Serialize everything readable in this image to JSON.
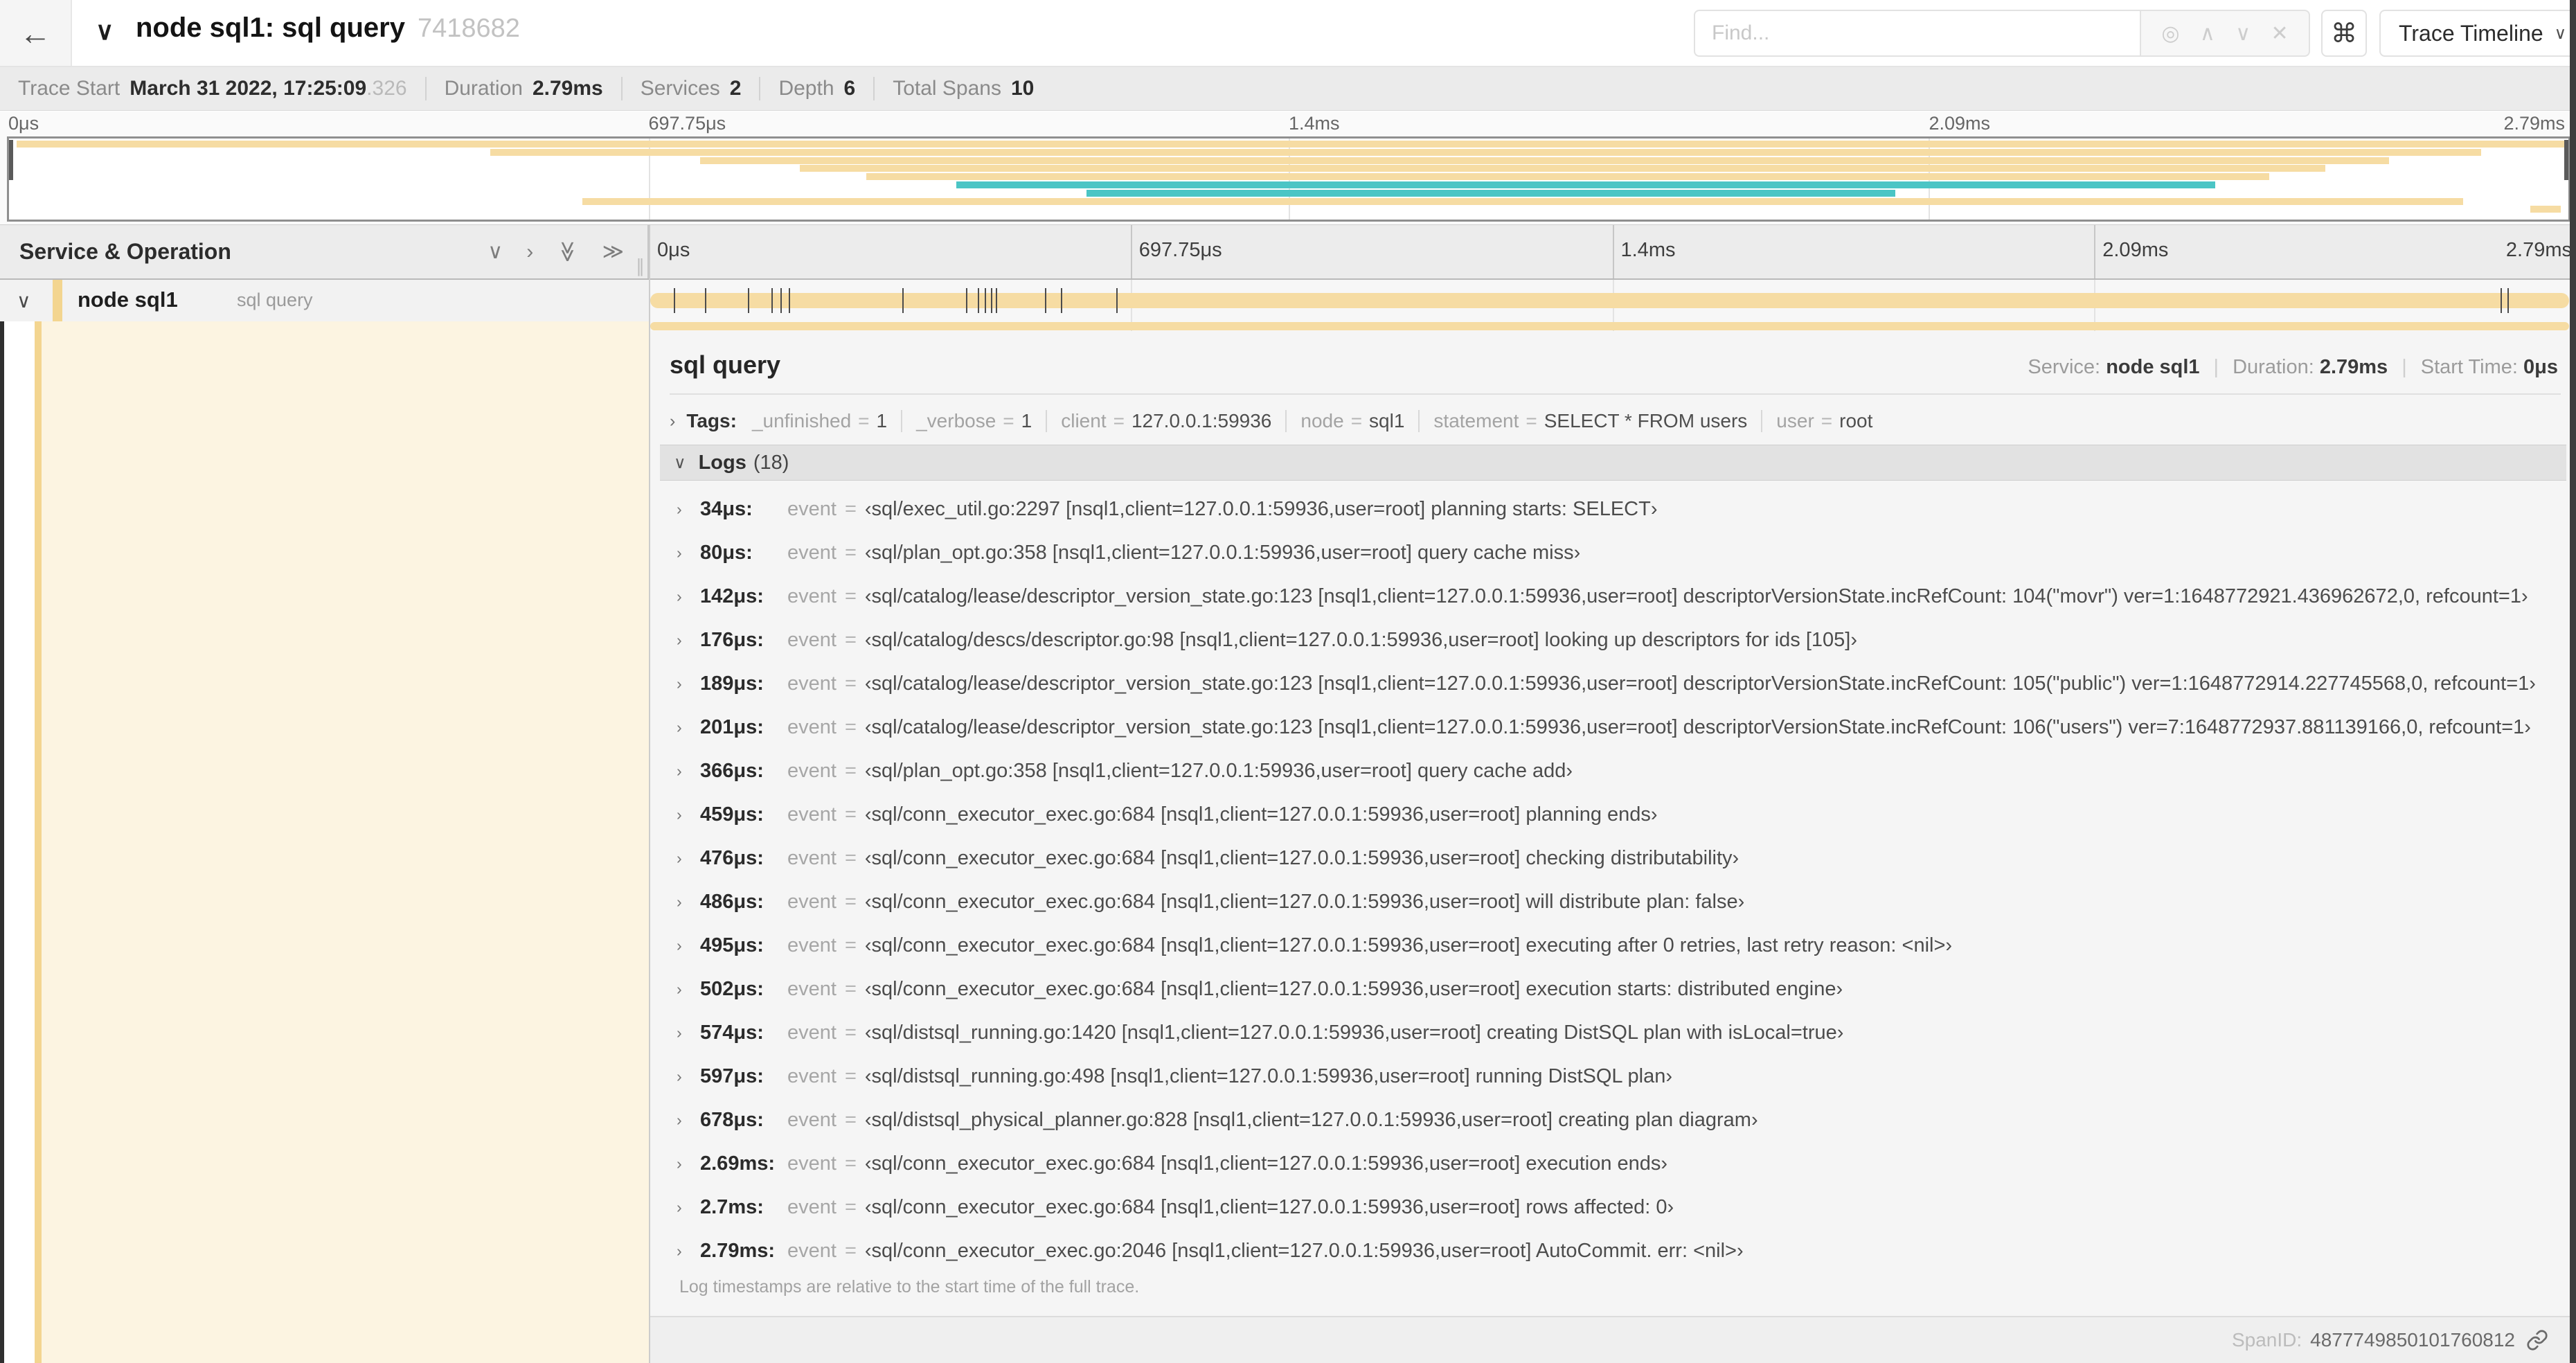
{
  "colors": {
    "tan": "#F6DCA3",
    "teal": "#4BC5C5",
    "stripe": "#F3D590",
    "cream": "#FCF4E1"
  },
  "icons": {
    "back": "←",
    "chevron_down": "∨",
    "chevron_right": "›",
    "double_chevron": "≫",
    "target": "◎",
    "up": "∧",
    "down": "∨",
    "close": "✕",
    "command": "⌘",
    "grip": "∥"
  },
  "header": {
    "title": "node sql1: sql query",
    "trace_id_short": "7418682",
    "find_placeholder": "Find...",
    "view_label": "Trace Timeline"
  },
  "trace_info": {
    "trace_start_label": "Trace Start",
    "trace_start": "March 31 2022, 17:25:09",
    "trace_start_frac": ".326",
    "duration_label": "Duration",
    "duration": "2.79ms",
    "services_label": "Services",
    "services": "2",
    "depth_label": "Depth",
    "depth": "6",
    "total_spans_label": "Total Spans",
    "total_spans": "10"
  },
  "timeline": {
    "header_left": "Service & Operation",
    "duration_us": 2790,
    "ticks": [
      {
        "label": "0μs",
        "pct": 0
      },
      {
        "label": "697.75μs",
        "pct": 25
      },
      {
        "label": "1.4ms",
        "pct": 50
      },
      {
        "label": "2.09ms",
        "pct": 75
      },
      {
        "label": "2.79ms",
        "pct": 100
      }
    ]
  },
  "minimap_bars": [
    {
      "row": 0,
      "from": 0.3,
      "to": 100,
      "color": "tan"
    },
    {
      "row": 1,
      "from": 18.8,
      "to": 96.6,
      "color": "tan"
    },
    {
      "row": 2,
      "from": 27.0,
      "to": 93.0,
      "color": "tan"
    },
    {
      "row": 3,
      "from": 30.9,
      "to": 90.5,
      "color": "tan"
    },
    {
      "row": 4,
      "from": 33.5,
      "to": 88.3,
      "color": "tan"
    },
    {
      "row": 5,
      "from": 37.0,
      "to": 86.2,
      "color": "teal"
    },
    {
      "row": 6,
      "from": 42.1,
      "to": 73.7,
      "color": "teal"
    },
    {
      "row": 7,
      "from": 22.4,
      "to": 95.9,
      "color": "tan"
    },
    {
      "row": 8,
      "from": 98.5,
      "to": 99.7,
      "color": "tan"
    }
  ],
  "span_row": {
    "service": "node sql1",
    "operation": "sql query"
  },
  "detail": {
    "title": "sql query",
    "service_label": "Service:",
    "service": "node sql1",
    "duration_label": "Duration:",
    "duration": "2.79ms",
    "start_label": "Start Time:",
    "start": "0μs",
    "tags_label": "Tags:",
    "tags": [
      {
        "key": "_unfinished",
        "value": "1"
      },
      {
        "key": "_verbose",
        "value": "1"
      },
      {
        "key": "client",
        "value": "127.0.0.1:59936"
      },
      {
        "key": "node",
        "value": "sql1"
      },
      {
        "key": "statement",
        "value": "SELECT * FROM users"
      },
      {
        "key": "user",
        "value": "root"
      }
    ],
    "logs_label": "Logs",
    "logs_count": "(18)",
    "logs": [
      {
        "t": 34,
        "time": "34μs:",
        "field": "event",
        "value": "‹sql/exec_util.go:2297 [nsql1,client=127.0.0.1:59936,user=root] planning starts: SELECT›"
      },
      {
        "t": 80,
        "time": "80μs:",
        "field": "event",
        "value": "‹sql/plan_opt.go:358 [nsql1,client=127.0.0.1:59936,user=root] query cache miss›"
      },
      {
        "t": 142,
        "time": "142μs:",
        "field": "event",
        "value": "‹sql/catalog/lease/descriptor_version_state.go:123 [nsql1,client=127.0.0.1:59936,user=root] descriptorVersionState.incRefCount: 104(\"movr\") ver=1:1648772921.436962672,0, refcount=1›"
      },
      {
        "t": 176,
        "time": "176μs:",
        "field": "event",
        "value": "‹sql/catalog/descs/descriptor.go:98 [nsql1,client=127.0.0.1:59936,user=root] looking up descriptors for ids [105]›"
      },
      {
        "t": 189,
        "time": "189μs:",
        "field": "event",
        "value": "‹sql/catalog/lease/descriptor_version_state.go:123 [nsql1,client=127.0.0.1:59936,user=root] descriptorVersionState.incRefCount: 105(\"public\") ver=1:1648772914.227745568,0, refcount=1›"
      },
      {
        "t": 201,
        "time": "201μs:",
        "field": "event",
        "value": "‹sql/catalog/lease/descriptor_version_state.go:123 [nsql1,client=127.0.0.1:59936,user=root] descriptorVersionState.incRefCount: 106(\"users\") ver=7:1648772937.881139166,0, refcount=1›"
      },
      {
        "t": 366,
        "time": "366μs:",
        "field": "event",
        "value": "‹sql/plan_opt.go:358 [nsql1,client=127.0.0.1:59936,user=root] query cache add›"
      },
      {
        "t": 459,
        "time": "459μs:",
        "field": "event",
        "value": "‹sql/conn_executor_exec.go:684 [nsql1,client=127.0.0.1:59936,user=root] planning ends›"
      },
      {
        "t": 476,
        "time": "476μs:",
        "field": "event",
        "value": "‹sql/conn_executor_exec.go:684 [nsql1,client=127.0.0.1:59936,user=root] checking distributability›"
      },
      {
        "t": 486,
        "time": "486μs:",
        "field": "event",
        "value": "‹sql/conn_executor_exec.go:684 [nsql1,client=127.0.0.1:59936,user=root] will distribute plan: false›"
      },
      {
        "t": 495,
        "time": "495μs:",
        "field": "event",
        "value": "‹sql/conn_executor_exec.go:684 [nsql1,client=127.0.0.1:59936,user=root] executing after 0 retries, last retry reason: <nil>›"
      },
      {
        "t": 502,
        "time": "502μs:",
        "field": "event",
        "value": "‹sql/conn_executor_exec.go:684 [nsql1,client=127.0.0.1:59936,user=root] execution starts: distributed engine›"
      },
      {
        "t": 574,
        "time": "574μs:",
        "field": "event",
        "value": "‹sql/distsql_running.go:1420 [nsql1,client=127.0.0.1:59936,user=root] creating DistSQL plan with isLocal=true›"
      },
      {
        "t": 597,
        "time": "597μs:",
        "field": "event",
        "value": "‹sql/distsql_running.go:498 [nsql1,client=127.0.0.1:59936,user=root] running DistSQL plan›"
      },
      {
        "t": 678,
        "time": "678μs:",
        "field": "event",
        "value": "‹sql/distsql_physical_planner.go:828 [nsql1,client=127.0.0.1:59936,user=root] creating plan diagram›"
      },
      {
        "t": 2690,
        "time": "2.69ms:",
        "field": "event",
        "value": "‹sql/conn_executor_exec.go:684 [nsql1,client=127.0.0.1:59936,user=root] execution ends›"
      },
      {
        "t": 2700,
        "time": "2.7ms:",
        "field": "event",
        "value": "‹sql/conn_executor_exec.go:684 [nsql1,client=127.0.0.1:59936,user=root] rows affected: 0›"
      },
      {
        "t": 2790,
        "time": "2.79ms:",
        "field": "event",
        "value": "‹sql/conn_executor_exec.go:2046 [nsql1,client=127.0.0.1:59936,user=root] AutoCommit. err: <nil>›"
      }
    ],
    "footer_note": "Log timestamps are relative to the start time of the full trace.",
    "spanid_label": "SpanID:",
    "spanid": "4877749850101760812"
  }
}
